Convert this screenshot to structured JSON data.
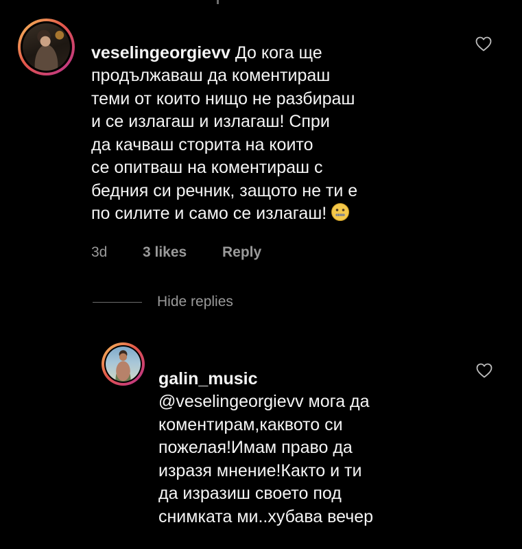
{
  "comments": [
    {
      "username": "veselingeorgievv",
      "text_first": " До кога ще",
      "lines_rest": "продължаваш да коментираш\nтеми от които нищо не разбираш\nи се излагаш и излагаш! Спри\nда качваш сторита на които\nсе опитваш на коментираш с\nбедния си речник, защото не ти е\nпо силите и само се излагаш!",
      "emoji": "zipper-mouth-face-emoji",
      "time": "3d",
      "likes": "3 likes",
      "reply_label": "Reply",
      "like_icon": "heart-outline-icon"
    },
    {
      "username": "galin_music",
      "mention": "@veselingeorgievv",
      "text": "@veselingeorgievv мога да\nкоментирам,каквото си\nпожелая!Имам право да\nизразя мнение!Както и ти\nда изразиш своето под\nснимката ми..хубава вечер",
      "like_icon": "heart-outline-icon"
    }
  ],
  "thread": {
    "hide_replies_label": "Hide replies"
  },
  "colors": {
    "background": "#000000",
    "text": "#f5f5f5",
    "secondary": "#9a9a9a",
    "story_ring_start": "#f7c35c",
    "story_ring_end": "#b8308f"
  }
}
